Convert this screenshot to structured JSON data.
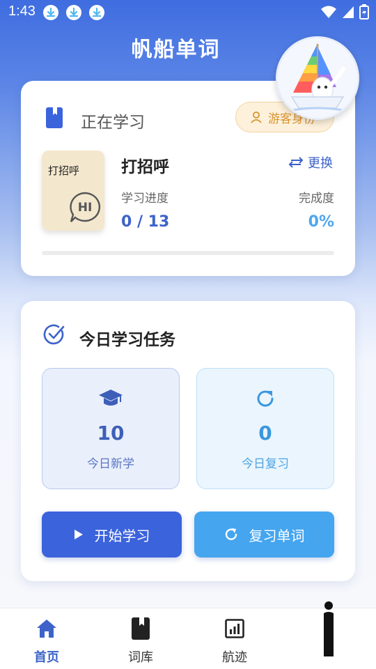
{
  "status_bar": {
    "time": "1:43"
  },
  "header": {
    "title": "帆船单词"
  },
  "current_study": {
    "label": "正在学习",
    "guest_badge": "游客身份",
    "book": {
      "cover_title": "打招呼",
      "cover_art_text": "HI",
      "name": "打招呼"
    },
    "swap_label": "更换",
    "progress_label": "学习进度",
    "progress_value": "0 / 13",
    "completion_label": "完成度",
    "completion_value": "0%",
    "progress_fraction": 0
  },
  "today_tasks": {
    "title": "今日学习任务",
    "new": {
      "count": "10",
      "label": "今日新学"
    },
    "review": {
      "count": "0",
      "label": "今日复习"
    },
    "start_button": "开始学习",
    "review_button": "复习单词"
  },
  "nav": {
    "items": [
      {
        "label": "首页",
        "icon": "home-icon",
        "active": true
      },
      {
        "label": "词库",
        "icon": "book-icon",
        "active": false
      },
      {
        "label": "航迹",
        "icon": "chart-icon",
        "active": false
      },
      {
        "label": "",
        "icon": "profile-icon",
        "active": false
      }
    ]
  },
  "colors": {
    "primary": "#3d63c9",
    "accent_blue": "#45a5ef",
    "guest_orange": "#d8922c"
  }
}
